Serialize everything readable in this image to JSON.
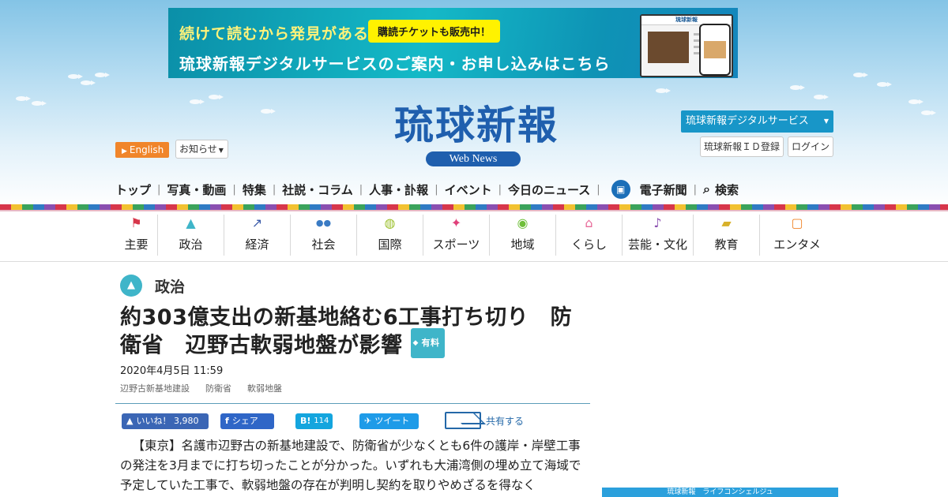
{
  "banner": {
    "line1": "続けて読むから発見がある",
    "badge": "購読チケットも販売中！",
    "line2": "琉球新報デジタルサービスのご案内・お申し込みはこちら",
    "mock_title": "琉球新報"
  },
  "header": {
    "logo": "琉球新報",
    "logo_sub": "Web News",
    "english": "English",
    "notice": "お知らせ",
    "digital_service": "琉球新報デジタルサービス",
    "id_register": "琉球新報ＩＤ登録",
    "login": "ログイン"
  },
  "topnav": {
    "items": [
      "トップ",
      "写真・動画",
      "特集",
      "社説・コラム",
      "人事・訃報",
      "イベント",
      "今日のニュース"
    ],
    "e_paper": "電子新聞",
    "search": "検索"
  },
  "categories": [
    {
      "label": "主要",
      "icon": "flag-icon",
      "glyph": "⚑",
      "color": "#d7364a"
    },
    {
      "label": "政治",
      "icon": "parliament-icon",
      "glyph": "▲",
      "color": "#3fb5c9"
    },
    {
      "label": "経済",
      "icon": "chart-icon",
      "glyph": "↗",
      "color": "#3a5aa8"
    },
    {
      "label": "社会",
      "icon": "people-icon",
      "glyph": "●●",
      "color": "#3a7bc4"
    },
    {
      "label": "国際",
      "icon": "globe-icon",
      "glyph": "◍",
      "color": "#9abf2a"
    },
    {
      "label": "スポーツ",
      "icon": "runner-icon",
      "glyph": "✦",
      "color": "#e0407a"
    },
    {
      "label": "地域",
      "icon": "map-pin-icon",
      "glyph": "◉",
      "color": "#6fbf3a"
    },
    {
      "label": "くらし",
      "icon": "house-icon",
      "glyph": "⌂",
      "color": "#e86b9a"
    },
    {
      "label": "芸能・文化",
      "icon": "sanshin-icon",
      "glyph": "♪",
      "color": "#8a4fb0"
    },
    {
      "label": "教育",
      "icon": "graduation-cap-icon",
      "glyph": "▰",
      "color": "#d8b12a"
    },
    {
      "label": "エンタメ",
      "icon": "tv-icon",
      "glyph": "▢",
      "color": "#f0852a"
    }
  ],
  "article": {
    "section": "政治",
    "headline": "約303億支出の新基地絡む6工事打ち切り　防衛省　辺野古軟弱地盤が影響",
    "paid_label": "有料",
    "date": "2020年4月5日 11:59",
    "tags": [
      "辺野古新基地建設",
      "防衛省",
      "軟弱地盤"
    ],
    "body": "【東京】名護市辺野古の新基地建設で、防衛省が少なくとも6件の護岸・岸壁工事の発注を3月までに打ち切ったことが分かった。いずれも大浦湾側の埋め立て海域で予定していた工事で、軟弱地盤の存在が判明し契約を取りやめざるを得なく"
  },
  "share": {
    "like": "いいね！",
    "like_count": "3,980",
    "fb_share": "シェア",
    "hatena": "B!",
    "hatena_count": "114",
    "tweet": "ツイート",
    "mail": "共有する"
  },
  "sidebar": {
    "ad_text": "琉球新報　ライフコンシェルジュ"
  }
}
